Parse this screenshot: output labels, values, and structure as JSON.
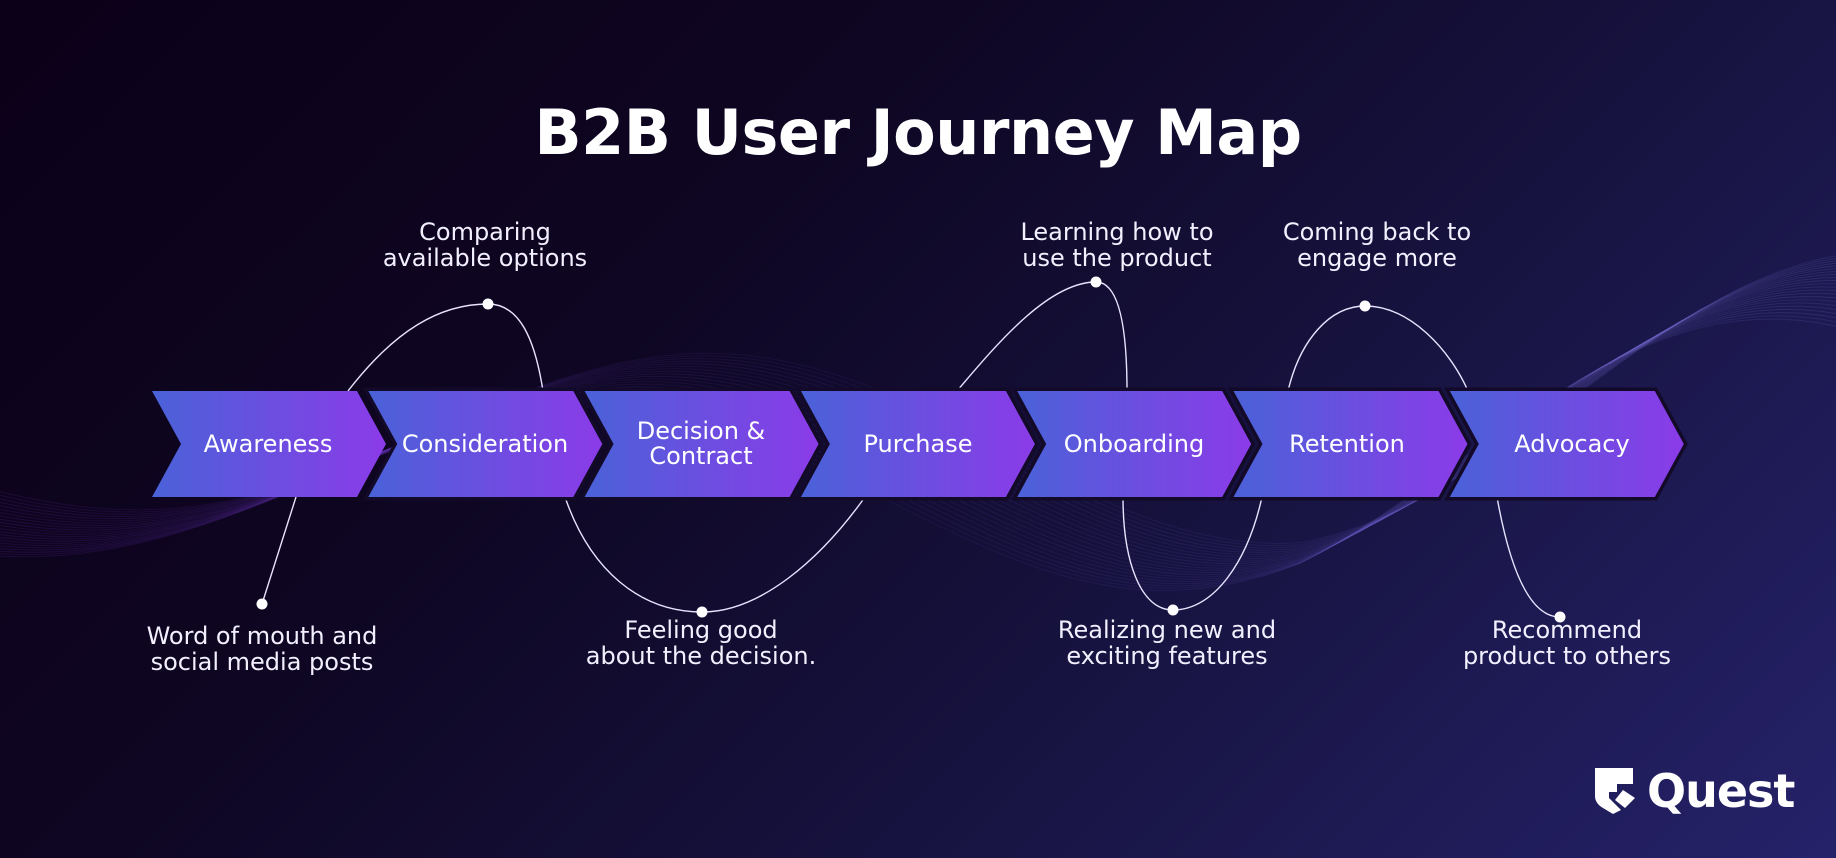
{
  "title": "B2B User Journey Map",
  "colors": {
    "chevron_start": "#4a62d8",
    "chevron_end": "#8b3be8",
    "line": "#e8e4ff",
    "dot": "#ffffff",
    "bg_start": "#0c0018",
    "bg_end": "#25226a"
  },
  "stages": [
    {
      "label": "Awareness"
    },
    {
      "label": "Consideration"
    },
    {
      "label": "Decision &\nContract",
      "line1": "Decision &",
      "line2": "Contract"
    },
    {
      "label": "Purchase"
    },
    {
      "label": "Onboarding"
    },
    {
      "label": "Retention"
    },
    {
      "label": "Advocacy"
    }
  ],
  "annotations": [
    {
      "stage": "Awareness",
      "position": "bottom",
      "line1": "Word of mouth and",
      "line2": "social media posts"
    },
    {
      "stage": "Consideration",
      "position": "top",
      "line1": "Comparing",
      "line2": "available options"
    },
    {
      "stage": "Decision & Contract",
      "position": "bottom",
      "line1": "Feeling good",
      "line2": "about the decision."
    },
    {
      "stage": "Onboarding",
      "position": "top",
      "line1": "Learning how to",
      "line2": "use the product"
    },
    {
      "stage": "Onboarding",
      "position": "bottom",
      "line1": "Realizing new and",
      "line2": "exciting features"
    },
    {
      "stage": "Retention",
      "position": "top",
      "line1": "Coming back to",
      "line2": "engage more"
    },
    {
      "stage": "Advocacy",
      "position": "bottom",
      "line1": "Recommend",
      "line2": "product to others"
    }
  ],
  "logo": {
    "text": "Quest",
    "icon": "quest-logo-icon"
  }
}
